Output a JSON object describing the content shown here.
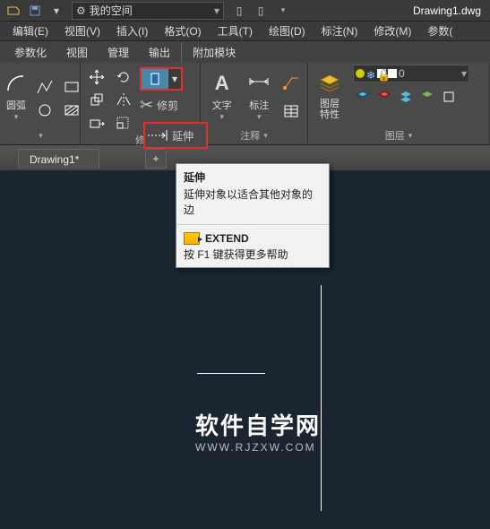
{
  "titlebar": {
    "workspace": "我的空间",
    "doc": "Drawing1.dwg"
  },
  "menus": {
    "edit": "编辑(E)",
    "view": "视图(V)",
    "insert": "插入(I)",
    "format": "格式(O)",
    "tools": "工具(T)",
    "draw": "绘图(D)",
    "dim": "标注(N)",
    "modify": "修改(M)",
    "param": "参数("
  },
  "tabs": {
    "t_param": "参数化",
    "t_view": "视图",
    "t_manage": "管理",
    "t_output": "输出",
    "t_addin": "附加模块"
  },
  "ribbon": {
    "arc": "圆弧",
    "trim": "修剪",
    "extend": "延伸",
    "text": "文字",
    "dim": "标注",
    "layerprops": "图层\n特性",
    "layer0": "0",
    "panel_modify": "修",
    "panel_annotate": "注释",
    "panel_layer": "图层"
  },
  "tooltip": {
    "title": "延伸",
    "desc": "延伸对象以适合其他对象的边",
    "cmd": "EXTEND",
    "help": "按 F1 键获得更多帮助"
  },
  "doctab": {
    "name": "Drawing1*",
    "plus": "+"
  },
  "watermark": {
    "line1": "软件自学网",
    "line2": "WWW.RJZXW.COM"
  }
}
